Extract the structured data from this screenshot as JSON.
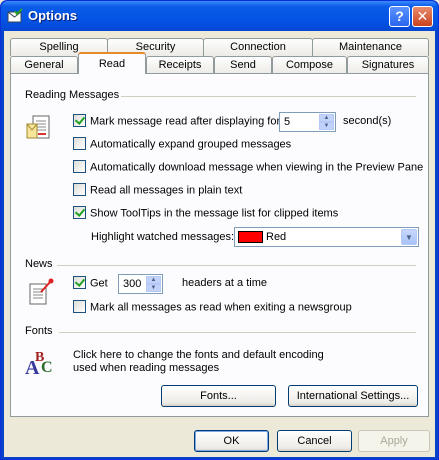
{
  "window": {
    "title": "Options",
    "help_glyph": "?",
    "close_glyph": "✕"
  },
  "tabs_row_back": [
    {
      "label": "Spelling"
    },
    {
      "label": "Security"
    },
    {
      "label": "Connection"
    },
    {
      "label": "Maintenance"
    }
  ],
  "tabs_row_front": [
    {
      "label": "General"
    },
    {
      "label": "Read",
      "active": true
    },
    {
      "label": "Receipts"
    },
    {
      "label": "Send"
    },
    {
      "label": "Compose"
    },
    {
      "label": "Signatures"
    }
  ],
  "reading": {
    "group_label": "Reading Messages",
    "mark_read": {
      "label": "Mark message read after displaying for",
      "checked": true
    },
    "mark_read_seconds": "5",
    "seconds_label": "second(s)",
    "expand_groups": {
      "label": "Automatically expand grouped messages",
      "checked": false
    },
    "auto_download": {
      "label": "Automatically download message when viewing in the Preview Pane",
      "checked": false
    },
    "plain_text": {
      "label": "Read all messages in plain text",
      "checked": false
    },
    "tooltips": {
      "label": "Show ToolTips in the message list for clipped items",
      "checked": true
    },
    "highlight_label": "Highlight watched messages:",
    "highlight_value": "Red",
    "highlight_color": "#ff0000"
  },
  "news": {
    "group_label": "News",
    "get": {
      "label": "Get",
      "checked": true
    },
    "get_count": "300",
    "headers_label": "headers at a time",
    "mark_all_read": {
      "label": "Mark all messages as read when exiting a newsgroup",
      "checked": false
    }
  },
  "fonts": {
    "group_label": "Fonts",
    "description_line1": "Click here to change the fonts and default encoding",
    "description_line2": "used when reading messages",
    "fonts_button": "Fonts...",
    "intl_button": "International Settings..."
  },
  "footer": {
    "ok": "OK",
    "cancel": "Cancel",
    "apply": "Apply"
  }
}
